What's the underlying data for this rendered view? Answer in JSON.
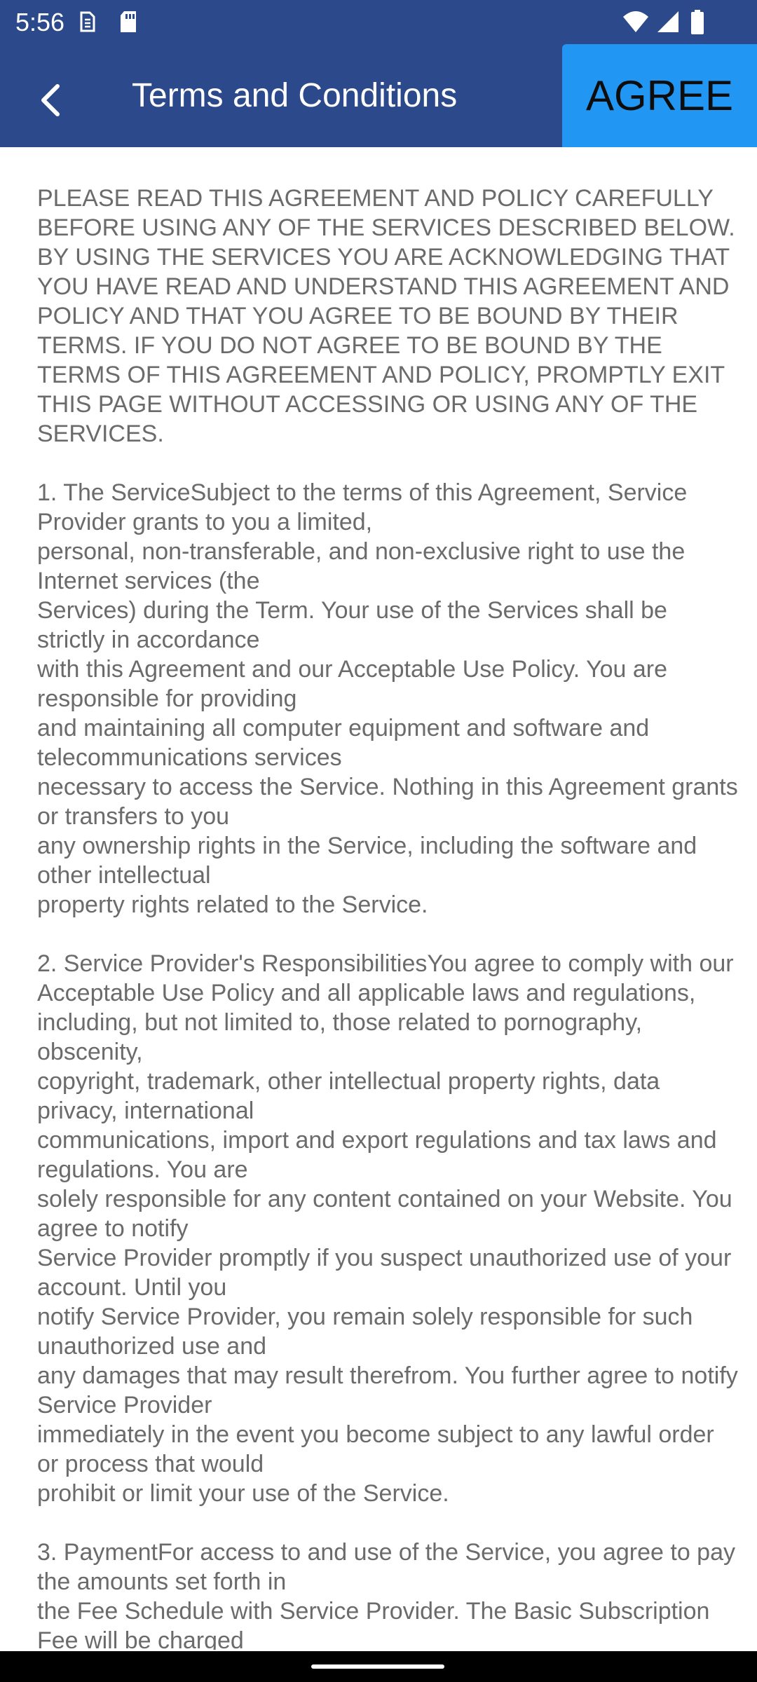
{
  "status_bar": {
    "time": "5:56",
    "icons": [
      "sim-icon",
      "sd-card-icon",
      "wifi-icon",
      "signal-icon",
      "battery-icon"
    ]
  },
  "app_bar": {
    "title": "Terms and Conditions",
    "agree_label": "AGREE",
    "back_icon": "chevron-left-icon"
  },
  "colors": {
    "app_bar": "#2c4a8b",
    "agree_button": "#2196f3",
    "body_text": "#6b6b6b"
  },
  "terms": {
    "intro": "PLEASE READ THIS AGREEMENT AND POLICY CAREFULLY BEFORE USING ANY OF THE SERVICES DESCRIBED BELOW. BY USING THE SERVICES YOU ARE ACKNOWLEDGING THAT YOU HAVE READ AND UNDERSTAND THIS AGREEMENT AND POLICY AND THAT YOU AGREE TO BE BOUND BY THEIR TERMS. IF YOU DO NOT AGREE TO BE BOUND BY THE TERMS OF THIS AGREEMENT AND POLICY, PROMPTLY EXIT THIS PAGE WITHOUT ACCESSING OR USING ANY OF THE SERVICES.",
    "section_1": "1.  The ServiceSubject to the terms of this Agreement, Service Provider grants to you a limited,\npersonal, non-transferable, and non-exclusive right to use the Internet services (the\nServices) during the Term. Your use of the Services shall be strictly in accordance\nwith this Agreement and our Acceptable Use Policy. You are responsible for providing\nand maintaining all computer equipment and software and telecommunications services\nnecessary to access the Service. Nothing in this Agreement grants or transfers to you\nany ownership rights in the Service, including the software and other intellectual\nproperty rights related to the Service.",
    "section_2": "2.  Service Provider's ResponsibilitiesYou agree to comply with our Acceptable Use Policy and all applicable laws and regulations, including, but not limited to, those related to pornography, obscenity,\ncopyright, trademark, other intellectual property rights, data privacy, international\ncommunications, import and export regulations and tax laws and regulations. You are\nsolely responsible for any content contained on your Website. You agree to notify\nService Provider promptly if you suspect unauthorized use of your account. Until you\nnotify Service Provider, you remain solely responsible for such unauthorized use and\nany damages that may result therefrom. You further agree to notify Service Provider\nimmediately in the event you become subject to any lawful order or process that would\nprohibit or limit your use of the Service.",
    "section_3": "3. PaymentFor access to and use of the Service, you agree to pay the amounts set forth in\nthe Fee Schedule with Service Provider. The Basic Subscription Fee will be charged"
  }
}
